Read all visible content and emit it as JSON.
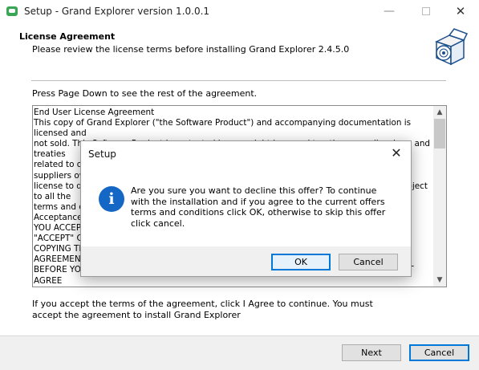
{
  "window": {
    "title": "Setup - Grand Explorer version 1.0.0.1",
    "minimize_glyph": "—",
    "close_glyph": "✕"
  },
  "header": {
    "title": "License Agreement",
    "subtitle": "Please review the license terms before installing Grand Explorer 2.4.5.0",
    "icon": "software-box-icon"
  },
  "main": {
    "pagedown_hint": "Press Page Down to see the rest of the agreement.",
    "license_text": "End User License Agreement\nThis copy of Grand Explorer (\"the Software Product\") and accompanying documentation is licensed and\nnot sold. This Software Product is protected by copyright laws and treaties, as well as laws and treaties\nrelated to other forms of intellectual property.\nsuppliers own the intellectual property rights in the Software Product.\nlicense to download, install, use, or otherwise transfer the Software Product is granted subject to all the\nterms and conditions herein.\nAcceptance\nYOU ACCEPT AND AGREE TO BE BOUND BY THE TERMS OF THIS AGREEMENT BY CLICKING\n\"ACCEPT\" OR BY DOWNLOADING, INSTALLING, USING, OR OR\nCOPYING THE SOFTWARE PRODUCT. YOU MUST AGREE TO ALL OF THE TERMS OF THIS AGREEMENT\nBEFORE YOU WILL BE ALLOWED TO DOWNLOAD THE SOFTWARE PRODUCT. IF YOU DO NOT AGREE\nTO ALL OF THE TERMS OF THIS AGREEMENT, YOU MUST NOT\nINSTALL, USE OR COPY THE SOFTWARE PRODUCT.\nLicense Grant\nThis Agreement entitles you to install and use one copy of the Software Product. In addition, you may\nmake one archival copy of the Software Product. The archival copy must be on a storage medium other\nthan a hard drive, and may only be used for the reinstallation of the Software Product.",
    "accept_text": "If you accept the terms of the agreement, click I Agree to continue. You must accept the agreement to install Grand Explorer",
    "scroll_up_glyph": "▲",
    "scroll_down_glyph": "▼"
  },
  "footer": {
    "next_label": "Next",
    "cancel_label": "Cancel"
  },
  "dialog": {
    "title": "Setup",
    "close_glyph": "✕",
    "icon_glyph": "i",
    "message": "Are you sure you want to decline this offer? To continue with the installation and if you agree to the current offers terms and conditions click OK, otherwise to skip this offer click cancel.",
    "ok_label": "OK",
    "cancel_label": "Cancel"
  },
  "colors": {
    "accent": "#0078d7",
    "info_icon": "#1467c5",
    "app_icon": "#3aa655"
  }
}
